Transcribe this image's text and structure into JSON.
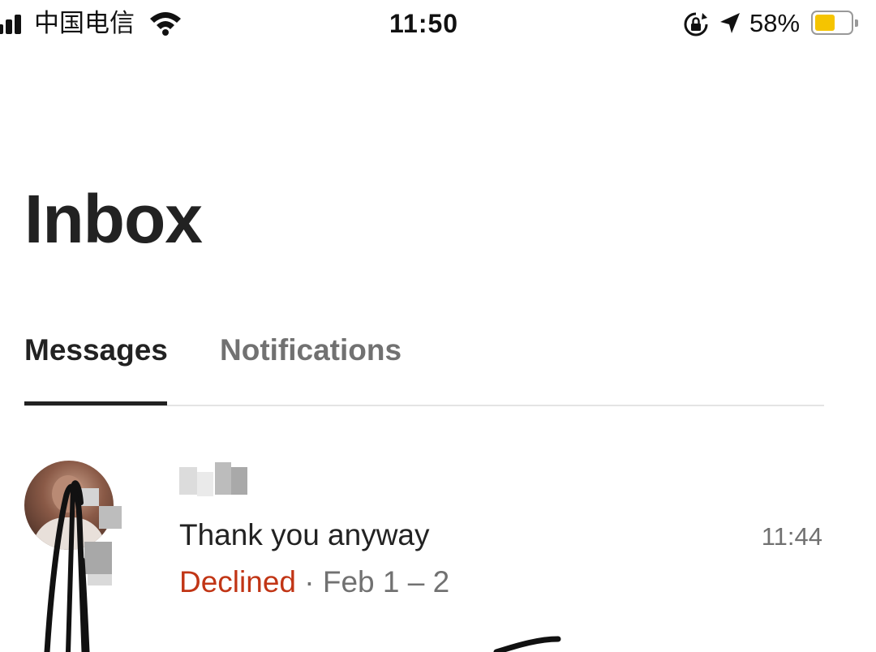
{
  "status_bar": {
    "carrier": "中国电信",
    "time": "11:50",
    "battery_percent": "58%",
    "battery_level": 0.58,
    "battery_color": "#f5c400",
    "icons": [
      "cell-signal-icon",
      "wifi-icon",
      "rotation-lock-icon",
      "location-arrow-icon",
      "battery-icon"
    ]
  },
  "header": {
    "title": "Inbox"
  },
  "tabs": [
    {
      "label": "Messages",
      "active": true
    },
    {
      "label": "Notifications",
      "active": false
    }
  ],
  "conversations": [
    {
      "message": "Thank you  anyway",
      "time": "11:44",
      "status": "Declined",
      "separator": "·",
      "dates": "Feb 1 – 2"
    }
  ],
  "colors": {
    "text_primary": "#222222",
    "text_secondary": "#717171",
    "declined": "#c13515"
  }
}
